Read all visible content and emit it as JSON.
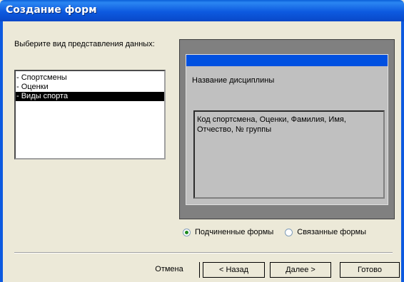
{
  "window": {
    "title": "Создание форм"
  },
  "prompt": "Выберите вид представления данных:",
  "list": {
    "items": [
      {
        "label": "- Спортсмены",
        "selected": false
      },
      {
        "label": "- Оценки",
        "selected": false
      },
      {
        "label": "- Виды спорта",
        "selected": true
      }
    ]
  },
  "preview": {
    "label": "Название дисциплины",
    "subform_text": "Код спортсмена, Оценки, Фамилия, Имя, Отчество, № группы"
  },
  "options": {
    "subforms_label": "Подчиненные формы",
    "linked_forms_label": "Связанные формы",
    "selected": "subforms"
  },
  "buttons": {
    "cancel": "Отмена",
    "back": "< Назад",
    "next": "Далее >",
    "finish": "Готово"
  }
}
